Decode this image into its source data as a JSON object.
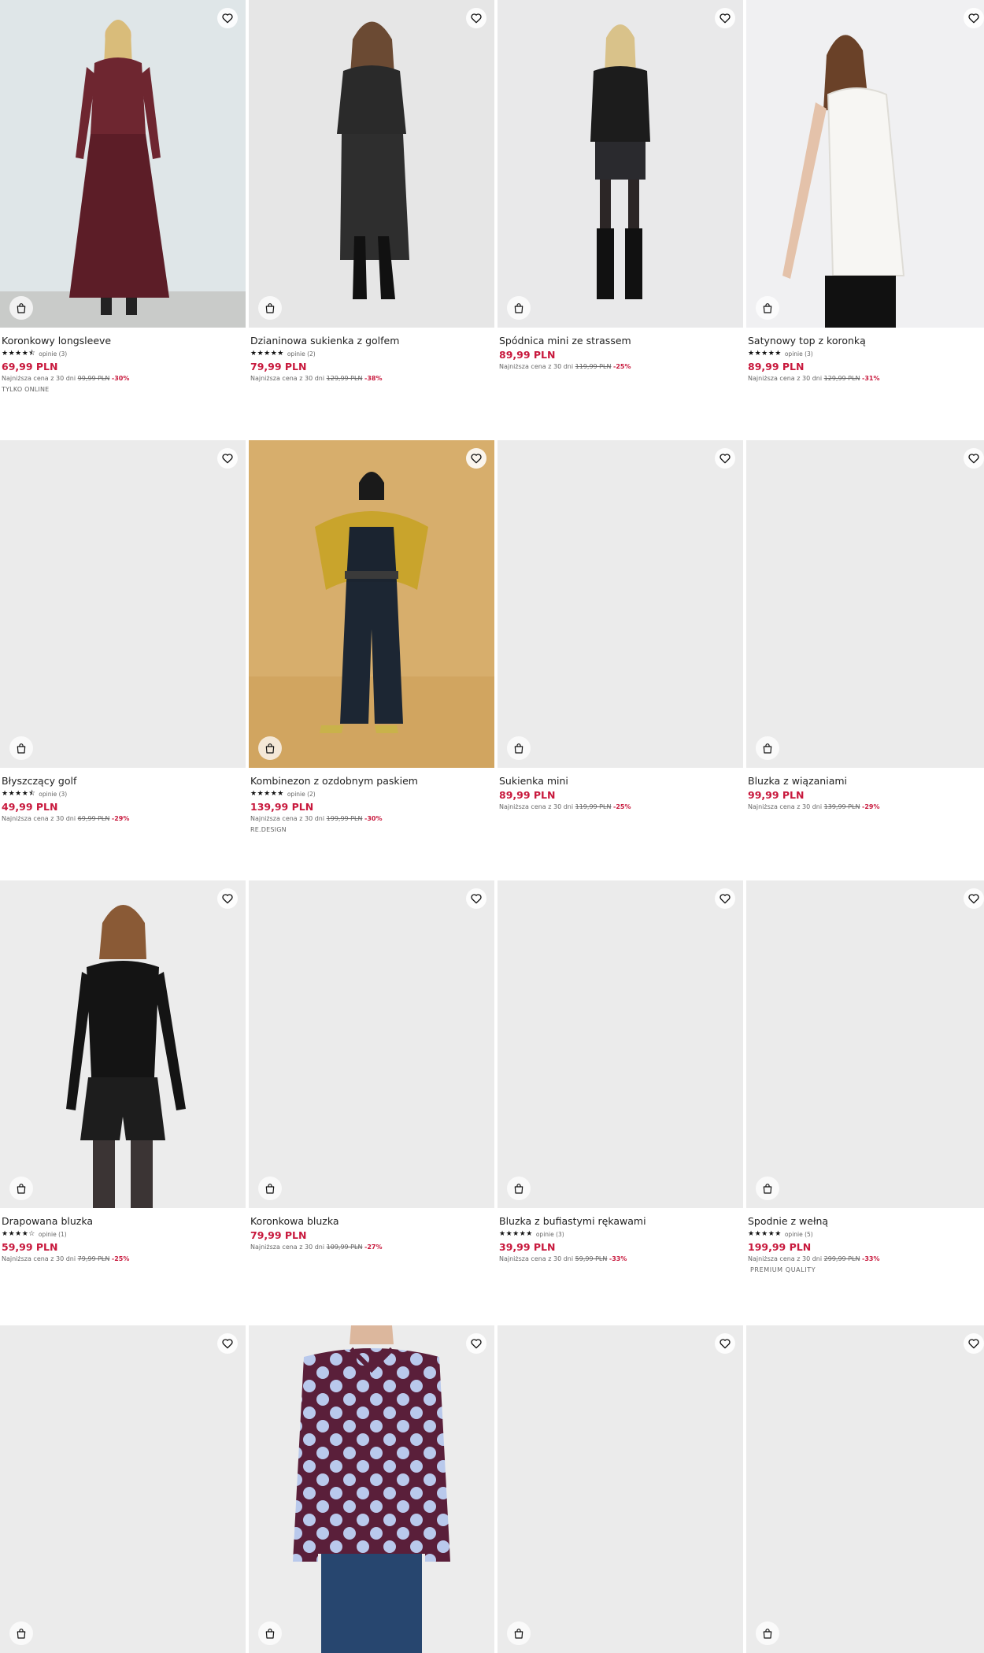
{
  "colors": {
    "price": "#c8193d",
    "photo_placeholder": "#ebebeb"
  },
  "icons": {
    "favorite": "heart-icon",
    "cart": "shopping-bag-icon"
  },
  "products": [
    {
      "name": "Koronkowy longsleeve",
      "rating": 4.5,
      "stars": "★★★★⯪",
      "opinions": "opinie (3)",
      "price": "69,99 PLN",
      "lowest_label": "Najniższa cena z 30 dni",
      "old_price": "99,99 PLN",
      "discount": "-30%",
      "tag": "TYLKO ONLINE"
    },
    {
      "name": "Dzianinowa sukienka z golfem",
      "rating": 5,
      "stars": "★★★★★",
      "opinions": "opinie (2)",
      "price": "79,99 PLN",
      "lowest_label": "Najniższa cena z 30 dni",
      "old_price": "129,99 PLN",
      "discount": "-38%",
      "tag": ""
    },
    {
      "name": "Spódnica mini ze strassem",
      "stars": "",
      "opinions": "",
      "price": "89,99 PLN",
      "lowest_label": "Najniższa cena z 30 dni",
      "old_price": "119,99 PLN",
      "discount": "-25%",
      "tag": ""
    },
    {
      "name": "Satynowy top z koronką",
      "rating": 5,
      "stars": "★★★★★",
      "opinions": "opinie (3)",
      "price": "89,99 PLN",
      "lowest_label": "Najniższa cena z 30 dni",
      "old_price": "129,99 PLN",
      "discount": "-31%",
      "tag": ""
    },
    {
      "name": "Błyszczący golf",
      "rating": 4.5,
      "stars": "★★★★⯪",
      "opinions": "opinie (3)",
      "price": "49,99 PLN",
      "lowest_label": "Najniższa cena z 30 dni",
      "old_price": "69,99 PLN",
      "discount": "-29%",
      "tag": ""
    },
    {
      "name": "Kombinezon z ozdobnym paskiem",
      "rating": 5,
      "stars": "★★★★★",
      "opinions": "opinie (2)",
      "price": "139,99 PLN",
      "lowest_label": "Najniższa cena z 30 dni",
      "old_price": "199,99 PLN",
      "discount": "-30%",
      "tag": "RE.DESIGN"
    },
    {
      "name": "Sukienka mini",
      "stars": "",
      "opinions": "",
      "price": "89,99 PLN",
      "lowest_label": "Najniższa cena z 30 dni",
      "old_price": "119,99 PLN",
      "discount": "-25%",
      "tag": ""
    },
    {
      "name": "Bluzka z wiązaniami",
      "stars": "",
      "opinions": "",
      "price": "99,99 PLN",
      "lowest_label": "Najniższa cena z 30 dni",
      "old_price": "139,99 PLN",
      "discount": "-29%",
      "tag": ""
    },
    {
      "name": "Drapowana bluzka",
      "rating": 4,
      "stars": "★★★★☆",
      "opinions": "opinie (1)",
      "price": "59,99 PLN",
      "lowest_label": "Najniższa cena z 30 dni",
      "old_price": "79,99 PLN",
      "discount": "-25%",
      "tag": ""
    },
    {
      "name": "Koronkowa bluzka",
      "stars": "",
      "opinions": "",
      "price": "79,99 PLN",
      "lowest_label": "Najniższa cena z 30 dni",
      "old_price": "109,99 PLN",
      "discount": "-27%",
      "tag": ""
    },
    {
      "name": "Bluzka z bufiastymi rękawami",
      "rating": 5,
      "stars": "★★★★★",
      "opinions": "opinie (3)",
      "price": "39,99 PLN",
      "lowest_label": "Najniższa cena z 30 dni",
      "old_price": "59,99 PLN",
      "discount": "-33%",
      "tag": ""
    },
    {
      "name": "Spodnie z wełną",
      "rating": 5,
      "stars": "★★★★★",
      "opinions": "opinie (5)",
      "price": "199,99 PLN",
      "lowest_label": "Najniższa cena z 30 dni",
      "old_price": "299,99 PLN",
      "discount": "-33%",
      "tag": "PREMIUM QUALITY"
    },
    {
      "name": "",
      "stars": "",
      "opinions": "",
      "price": "",
      "lowest_label": "",
      "old_price": "",
      "discount": "",
      "tag": ""
    },
    {
      "name": "",
      "stars": "",
      "opinions": "",
      "price": "",
      "lowest_label": "",
      "old_price": "",
      "discount": "",
      "tag": ""
    },
    {
      "name": "",
      "stars": "",
      "opinions": "",
      "price": "",
      "lowest_label": "",
      "old_price": "",
      "discount": "",
      "tag": ""
    },
    {
      "name": "",
      "stars": "",
      "opinions": "",
      "price": "",
      "lowest_label": "",
      "old_price": "",
      "discount": "",
      "tag": ""
    }
  ]
}
